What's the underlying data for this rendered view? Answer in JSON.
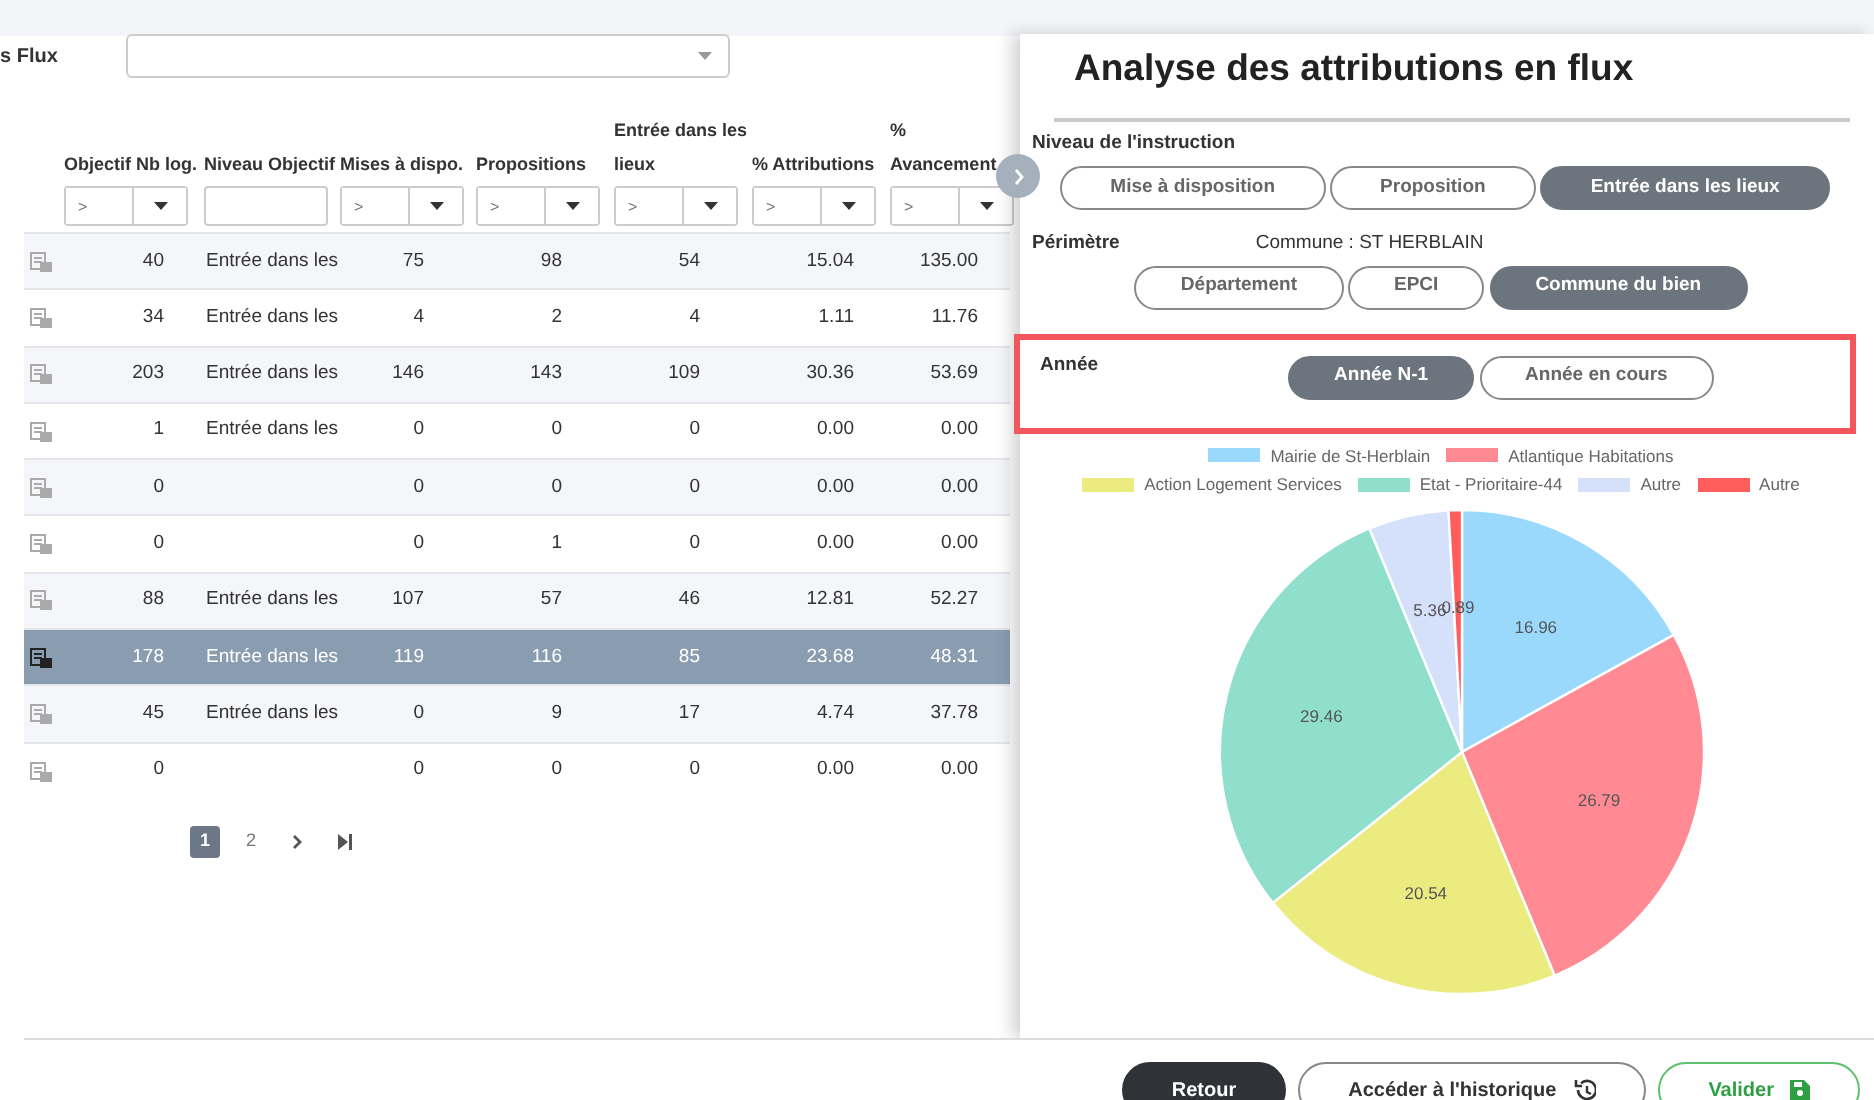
{
  "filter": {
    "label": "s Flux"
  },
  "table": {
    "columns": [
      {
        "label": "Objectif Nb log.",
        "kind": "number",
        "placeholder": ">"
      },
      {
        "label": "Niveau Objectif",
        "kind": "text"
      },
      {
        "label": "Mises à dispo.",
        "kind": "number",
        "placeholder": ">"
      },
      {
        "label": "Propositions",
        "kind": "number",
        "placeholder": ">"
      },
      {
        "label": "Entrée dans les lieux",
        "kind": "number",
        "placeholder": ">"
      },
      {
        "label": "% Attributions",
        "kind": "number",
        "placeholder": ">"
      },
      {
        "label": "% Avancement",
        "kind": "number",
        "placeholder": ">"
      }
    ],
    "rows": [
      {
        "selected": false,
        "cells": [
          "40",
          "Entrée dans les",
          "75",
          "98",
          "54",
          "15.04",
          "135.00"
        ]
      },
      {
        "selected": false,
        "cells": [
          "34",
          "Entrée dans les",
          "4",
          "2",
          "4",
          "1.11",
          "11.76"
        ]
      },
      {
        "selected": false,
        "cells": [
          "203",
          "Entrée dans les",
          "146",
          "143",
          "109",
          "30.36",
          "53.69"
        ]
      },
      {
        "selected": false,
        "cells": [
          "1",
          "Entrée dans les",
          "0",
          "0",
          "0",
          "0.00",
          "0.00"
        ]
      },
      {
        "selected": false,
        "cells": [
          "0",
          "",
          "0",
          "0",
          "0",
          "0.00",
          "0.00"
        ]
      },
      {
        "selected": false,
        "cells": [
          "0",
          "",
          "0",
          "1",
          "0",
          "0.00",
          "0.00"
        ]
      },
      {
        "selected": false,
        "cells": [
          "88",
          "Entrée dans les",
          "107",
          "57",
          "46",
          "12.81",
          "52.27"
        ]
      },
      {
        "selected": true,
        "cells": [
          "178",
          "Entrée dans les",
          "119",
          "116",
          "85",
          "23.68",
          "48.31"
        ]
      },
      {
        "selected": false,
        "cells": [
          "45",
          "Entrée dans les",
          "0",
          "9",
          "17",
          "4.74",
          "37.78"
        ]
      },
      {
        "selected": false,
        "cells": [
          "0",
          "",
          "0",
          "0",
          "0",
          "0.00",
          "0.00"
        ]
      }
    ]
  },
  "pagination": {
    "pages": [
      {
        "label": "1",
        "selected": true
      },
      {
        "label": "2",
        "selected": false
      }
    ]
  },
  "panel": {
    "title": "Analyse des attributions en flux",
    "sections": [
      {
        "label": "Niveau de l'instruction",
        "options": [
          {
            "label": "Mise à disposition",
            "selected": false
          },
          {
            "label": "Proposition",
            "selected": false
          },
          {
            "label": "Entrée dans les lieux",
            "selected": true
          }
        ]
      },
      {
        "label": "Périmètre",
        "value": "Commune : ST HERBLAIN",
        "options": [
          {
            "label": "Département",
            "selected": false
          },
          {
            "label": "EPCI",
            "selected": false
          },
          {
            "label": "Commune du bien",
            "selected": true
          }
        ]
      },
      {
        "label": "Année",
        "highlighted": true,
        "options": [
          {
            "label": "Année N-1",
            "selected": true
          },
          {
            "label": "Année en cours",
            "selected": false
          }
        ]
      }
    ],
    "chart_data": {
      "type": "pie",
      "legend": "top",
      "categories": [
        "Mairie de St-Herblain",
        "Atlantique Habitations",
        "Action Logement Services",
        "Etat - Prioritaire-44",
        "Autre",
        "Autre"
      ],
      "colors": [
        "#9ad9fc",
        "#ff8a93",
        "#ebeb80",
        "#8fdfcc",
        "#d5e0fb",
        "#ff5c5c"
      ],
      "values": [
        16.96,
        26.79,
        20.54,
        29.46,
        5.36,
        0.89
      ],
      "value_labels": [
        "16.96",
        "26.79",
        "20.54",
        "29.46",
        "5.36",
        "0.89"
      ]
    }
  },
  "footer": {
    "buttons": [
      {
        "label": "Retour",
        "kind": "back"
      },
      {
        "label": "Accéder à l'historique",
        "kind": "history"
      },
      {
        "label": "Valider",
        "kind": "save"
      }
    ]
  }
}
